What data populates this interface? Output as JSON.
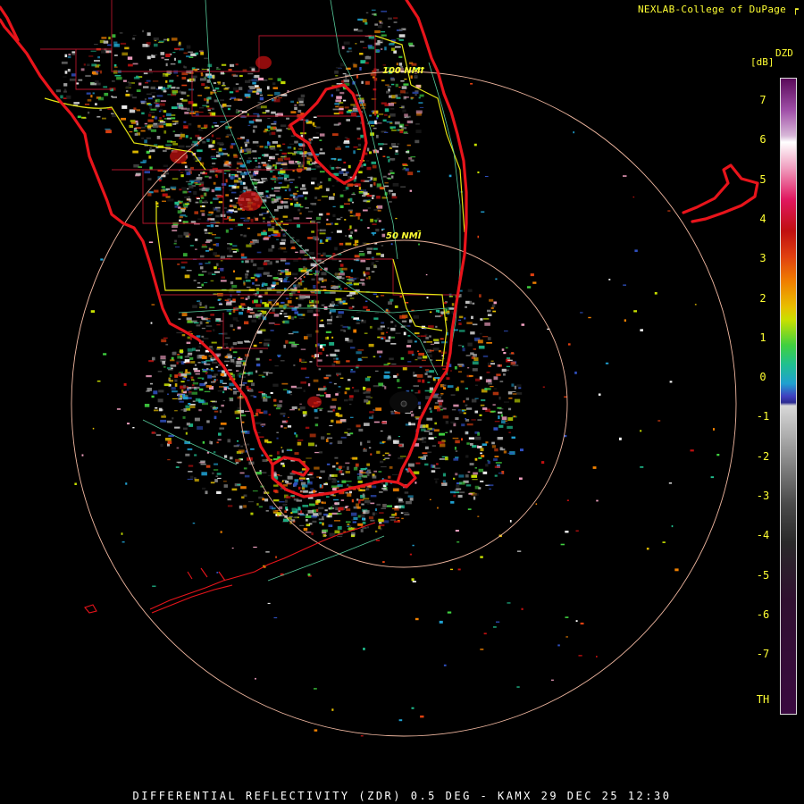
{
  "header": {
    "credit": "NEXLAB-College of DuPage"
  },
  "footer": {
    "caption": "DIFFERENTIAL REFLECTIVITY (ZDR) 0.5 DEG - KAMX 29 DEC 25 12:30"
  },
  "legend": {
    "product_code": "DZD",
    "unit": "[dB]",
    "ticks": [
      "7",
      "6",
      "5",
      "4",
      "3",
      "2",
      "1",
      "0",
      "-1",
      "-2",
      "-3",
      "-4",
      "-5",
      "-6",
      "-7",
      "TH"
    ]
  },
  "map": {
    "range_rings": [
      "50 NMI",
      "100 NMI"
    ],
    "colors": {
      "coast": "#e8141b",
      "county": "#b3152b",
      "boundary": "#e5e513",
      "ring": "#f0b7a0",
      "road": "#56c99a"
    }
  }
}
